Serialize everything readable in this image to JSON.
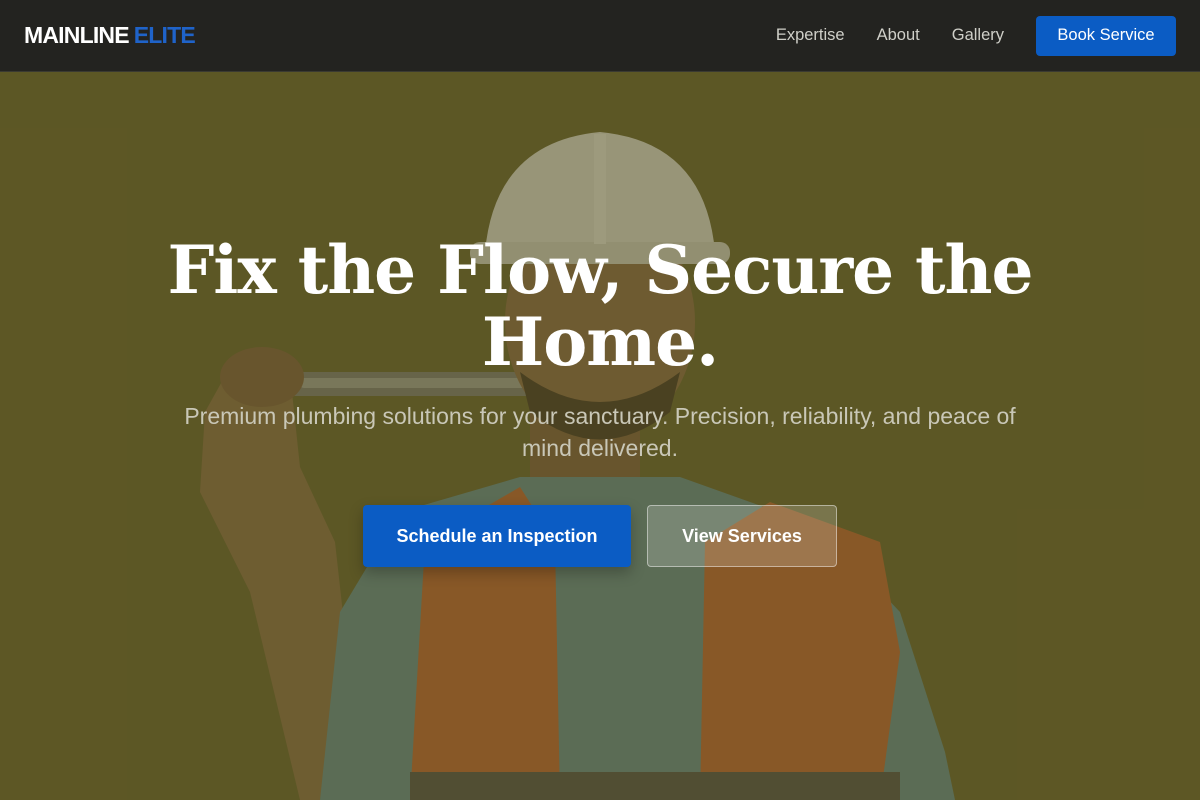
{
  "header": {
    "logo_main": "MAINLINE",
    "logo_accent": "ELITE",
    "nav": [
      {
        "label": "Expertise"
      },
      {
        "label": "About"
      },
      {
        "label": "Gallery"
      }
    ],
    "cta_label": "Book Service"
  },
  "hero": {
    "headline": "Fix the Flow, Secure the Home.",
    "subtitle": "Premium plumbing solutions for your sanctuary. Precision, reliability, and peace of mind delivered.",
    "primary_cta": "Schedule an Inspection",
    "secondary_cta": "View Services",
    "image_subject": "plumber with hard hat, safety vest and spirit level"
  },
  "colors": {
    "accent_blue": "#0b5cc4",
    "header_bg": "#232320",
    "hero_overlay": "#5f5a2a"
  }
}
